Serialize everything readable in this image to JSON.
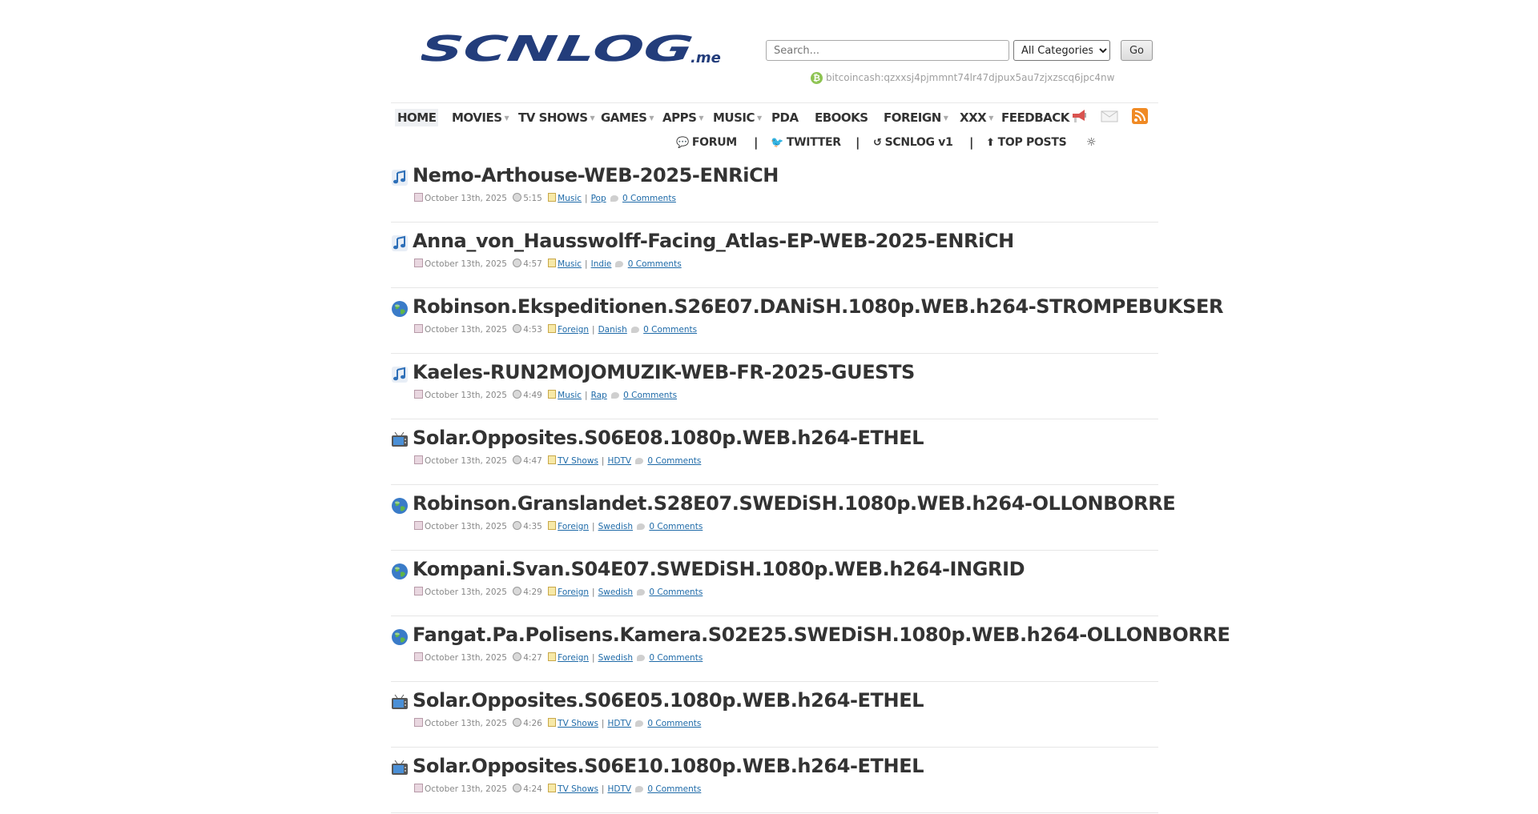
{
  "header": {
    "logo_text": "SCNLOG",
    "logo_suffix": ".me",
    "search": {
      "placeholder": "Search...",
      "value": ""
    },
    "category_select": {
      "selected": "All Categories"
    },
    "go_label": "Go",
    "bitcoin_address": "bitcoincash:qzxxsj4pjmmnt74lr47djpux5au7zjxzscq6jpc4nw"
  },
  "nav": {
    "items": [
      {
        "label": "HOME",
        "has_dropdown": false
      },
      {
        "label": "MOVIES",
        "has_dropdown": true
      },
      {
        "label": "TV SHOWS",
        "has_dropdown": true
      },
      {
        "label": "GAMES",
        "has_dropdown": true
      },
      {
        "label": "APPS",
        "has_dropdown": true
      },
      {
        "label": "MUSIC",
        "has_dropdown": true
      },
      {
        "label": "PDA",
        "has_dropdown": false
      },
      {
        "label": "EBOOKS",
        "has_dropdown": false
      },
      {
        "label": "FOREIGN",
        "has_dropdown": true
      },
      {
        "label": "XXX",
        "has_dropdown": true
      },
      {
        "label": "FEEDBACK",
        "has_dropdown": false
      }
    ],
    "icons": [
      "megaphone-icon",
      "mail-icon",
      "rss-icon"
    ]
  },
  "subnav": {
    "forum": "FORUM",
    "twitter": "TWITTER",
    "scnlog_v1": "SCNLOG v1",
    "top_posts": "TOP POSTS",
    "separator": "|"
  },
  "posts": [
    {
      "icon": "music-note-icon",
      "title": "Nemo-Arthouse-WEB-2025-ENRiCH",
      "date": "October 13th, 2025",
      "time": "5:15",
      "category": "Music",
      "subcategory": "Pop",
      "comments": "0 Comments"
    },
    {
      "icon": "music-note-icon",
      "title": "Anna_von_Hausswolff-Facing_Atlas-EP-WEB-2025-ENRiCH",
      "date": "October 13th, 2025",
      "time": "4:57",
      "category": "Music",
      "subcategory": "Indie",
      "comments": "0 Comments"
    },
    {
      "icon": "globe-icon",
      "title": "Robinson.Ekspeditionen.S26E07.DANiSH.1080p.WEB.h264-STROMPEBUKSER",
      "date": "October 13th, 2025",
      "time": "4:53",
      "category": "Foreign",
      "subcategory": "Danish",
      "comments": "0 Comments"
    },
    {
      "icon": "music-note-icon",
      "title": "Kaeles-RUN2MOJOMUZIK-WEB-FR-2025-GUESTS",
      "date": "October 13th, 2025",
      "time": "4:49",
      "category": "Music",
      "subcategory": "Rap",
      "comments": "0 Comments"
    },
    {
      "icon": "tv-icon",
      "title": "Solar.Opposites.S06E08.1080p.WEB.h264-ETHEL",
      "date": "October 13th, 2025",
      "time": "4:47",
      "category": "TV Shows",
      "subcategory": "HDTV",
      "comments": "0 Comments"
    },
    {
      "icon": "globe-icon",
      "title": "Robinson.Granslandet.S28E07.SWEDiSH.1080p.WEB.h264-OLLONBORRE",
      "date": "October 13th, 2025",
      "time": "4:35",
      "category": "Foreign",
      "subcategory": "Swedish",
      "comments": "0 Comments"
    },
    {
      "icon": "globe-icon",
      "title": "Kompani.Svan.S04E07.SWEDiSH.1080p.WEB.h264-INGRID",
      "date": "October 13th, 2025",
      "time": "4:29",
      "category": "Foreign",
      "subcategory": "Swedish",
      "comments": "0 Comments"
    },
    {
      "icon": "globe-icon",
      "title": "Fangat.Pa.Polisens.Kamera.S02E25.SWEDiSH.1080p.WEB.h264-OLLONBORRE",
      "date": "October 13th, 2025",
      "time": "4:27",
      "category": "Foreign",
      "subcategory": "Swedish",
      "comments": "0 Comments"
    },
    {
      "icon": "tv-icon",
      "title": "Solar.Opposites.S06E05.1080p.WEB.h264-ETHEL",
      "date": "October 13th, 2025",
      "time": "4:26",
      "category": "TV Shows",
      "subcategory": "HDTV",
      "comments": "0 Comments"
    },
    {
      "icon": "tv-icon",
      "title": "Solar.Opposites.S06E10.1080p.WEB.h264-ETHEL",
      "date": "October 13th, 2025",
      "time": "4:24",
      "category": "TV Shows",
      "subcategory": "HDTV",
      "comments": "0 Comments"
    }
  ]
}
